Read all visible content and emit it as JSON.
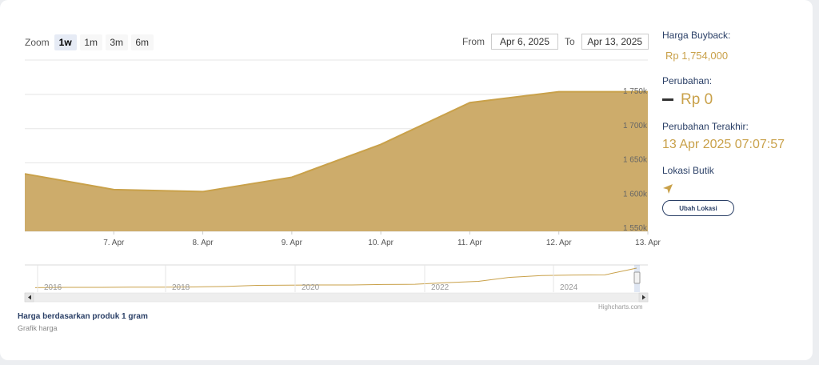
{
  "toolbar": {
    "zoom_label": "Zoom",
    "zoom_options": [
      "1w",
      "1m",
      "3m",
      "6m"
    ],
    "active_zoom": "1w",
    "from_label": "From",
    "from_value": "Apr 6, 2025",
    "to_label": "To",
    "to_value": "Apr 13, 2025"
  },
  "chart_data": {
    "type": "area",
    "title": "",
    "xlabel": "",
    "ylabel": "",
    "x": [
      "2025-04-06",
      "2025-04-07",
      "2025-04-08",
      "2025-04-09",
      "2025-04-10",
      "2025-04-11",
      "2025-04-12",
      "2025-04-13"
    ],
    "x_tick_labels": [
      "7. Apr",
      "8. Apr",
      "9. Apr",
      "10. Apr",
      "11. Apr",
      "12. Apr",
      "13. Apr"
    ],
    "y_tick_labels": [
      "1 550k",
      "1 600k",
      "1 650k",
      "1 700k",
      "1 750k"
    ],
    "ylim": [
      1550000,
      1750000
    ],
    "grid": true,
    "color": "#c9a14a",
    "fill_color": "#cdac6b",
    "series": [
      {
        "values": [
          1634000,
          1611000,
          1608000,
          1629000,
          1677000,
          1738000,
          1754000,
          1754000
        ]
      }
    ],
    "navigator": {
      "year_labels": [
        "2016",
        "2018",
        "2020",
        "2022",
        "2024"
      ],
      "values": [
        0.06,
        0.07,
        0.07,
        0.08,
        0.08,
        0.09,
        0.11,
        0.16,
        0.17,
        0.18,
        0.18,
        0.2,
        0.21,
        0.28,
        0.34,
        0.52,
        0.6,
        0.62,
        0.63,
        0.93
      ]
    }
  },
  "footer": {
    "title": "Harga berdasarkan produk 1 gram",
    "subtitle": "Grafik harga",
    "credits": "Highcharts.com"
  },
  "info": {
    "buyback_label": "Harga Buyback:",
    "buyback_value": "Rp 1,754,000",
    "change_label": "Perubahan:",
    "change_value": "Rp 0",
    "last_change_label": "Perubahan Terakhir:",
    "last_change_value": "13 Apr 2025 07:07:57",
    "location_label": "Lokasi Butik",
    "location_button": "Ubah Lokasi"
  },
  "icons": {
    "location": "navigation-arrow-icon",
    "change": "dash-icon"
  }
}
